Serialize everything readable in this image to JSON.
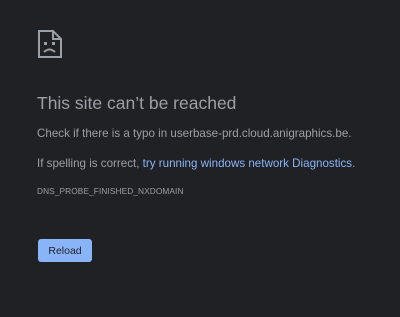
{
  "error": {
    "icon": "sad-document-icon",
    "title": "This site can’t be reached",
    "check_text": "Check if there is a typo in userbase-prd.cloud.anigraphics.be.",
    "spelling_prefix": "If spelling is correct, ",
    "diagnostics_link": "try running windows network Diagnostics",
    "diagnostics_suffix": ".",
    "error_code": "DNS_PROBE_FINISHED_NXDOMAIN",
    "reload_label": "Reload"
  },
  "colors": {
    "background": "#202124",
    "text": "#9aa0a6",
    "link": "#8ab4f8",
    "button": "#8ab4f8"
  }
}
